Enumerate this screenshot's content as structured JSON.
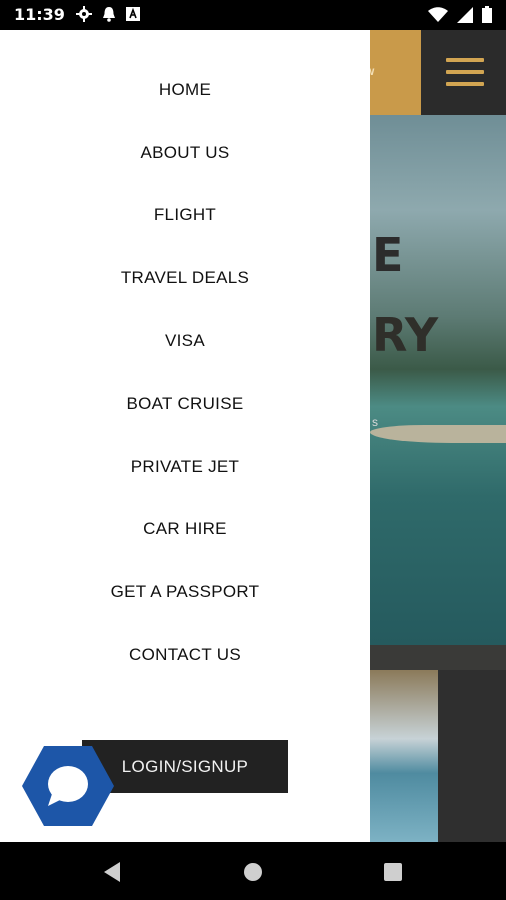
{
  "status_bar": {
    "time": "11:39",
    "left_icons": [
      "gear-icon",
      "bell-icon",
      "a-icon"
    ],
    "right_icons": [
      "wifi-icon",
      "signal-icon",
      "battery-icon"
    ]
  },
  "background_app": {
    "header_partial_text": "w",
    "hero_partial_text_1": "E",
    "hero_partial_text_2": "RY",
    "hero_partial_text_3": "s",
    "colors": {
      "gold": "#c99a4a",
      "dark": "#2b2b2b",
      "hamburger": "#d2a552"
    }
  },
  "drawer": {
    "menu_items": [
      {
        "label": "HOME"
      },
      {
        "label": "ABOUT US"
      },
      {
        "label": "FLIGHT"
      },
      {
        "label": "TRAVEL DEALS"
      },
      {
        "label": "VISA"
      },
      {
        "label": "BOAT CRUISE"
      },
      {
        "label": "PRIVATE JET"
      },
      {
        "label": "CAR HIRE"
      },
      {
        "label": "GET A PASSPORT"
      },
      {
        "label": "CONTACT US"
      }
    ],
    "login_label": "LOGIN/SIGNUP",
    "chat_color": "#1d56a8"
  },
  "nav_bar": {
    "icons": [
      "back-icon",
      "home-icon",
      "recents-icon"
    ]
  }
}
